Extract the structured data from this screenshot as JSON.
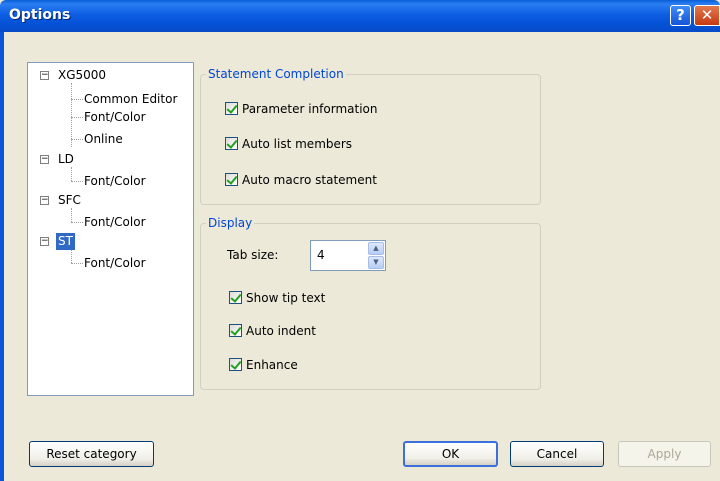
{
  "window": {
    "title": "Options"
  },
  "titlebar": {
    "help_glyph": "?",
    "close_glyph": "✕"
  },
  "tree": {
    "nodes": [
      {
        "label": "XG5000",
        "expander": "−"
      },
      {
        "label": "Common Editor"
      },
      {
        "label": "Font/Color"
      },
      {
        "label": "Online"
      },
      {
        "label": "LD",
        "expander": "−"
      },
      {
        "label": "Font/Color"
      },
      {
        "label": "SFC",
        "expander": "−"
      },
      {
        "label": "Font/Color"
      },
      {
        "label": "ST",
        "expander": "−",
        "selected": true
      },
      {
        "label": "Font/Color"
      }
    ]
  },
  "statement_completion": {
    "title": "Statement Completion",
    "items": [
      {
        "label": "Parameter information",
        "checked": true
      },
      {
        "label": "Auto list members",
        "checked": true
      },
      {
        "label": "Auto macro statement",
        "checked": true
      }
    ]
  },
  "display": {
    "title": "Display",
    "tab_size_label": "Tab size:",
    "tab_size_value": "4",
    "items": [
      {
        "label": "Show tip text",
        "checked": true
      },
      {
        "label": "Auto indent",
        "checked": true
      },
      {
        "label": "Enhance",
        "checked": true
      }
    ]
  },
  "buttons": {
    "reset": "Reset category",
    "ok": "OK",
    "cancel": "Cancel",
    "apply": "Apply"
  },
  "colors": {
    "titlebar": "#0553d8",
    "selection": "#316ac5",
    "group_label": "#0046d5"
  }
}
